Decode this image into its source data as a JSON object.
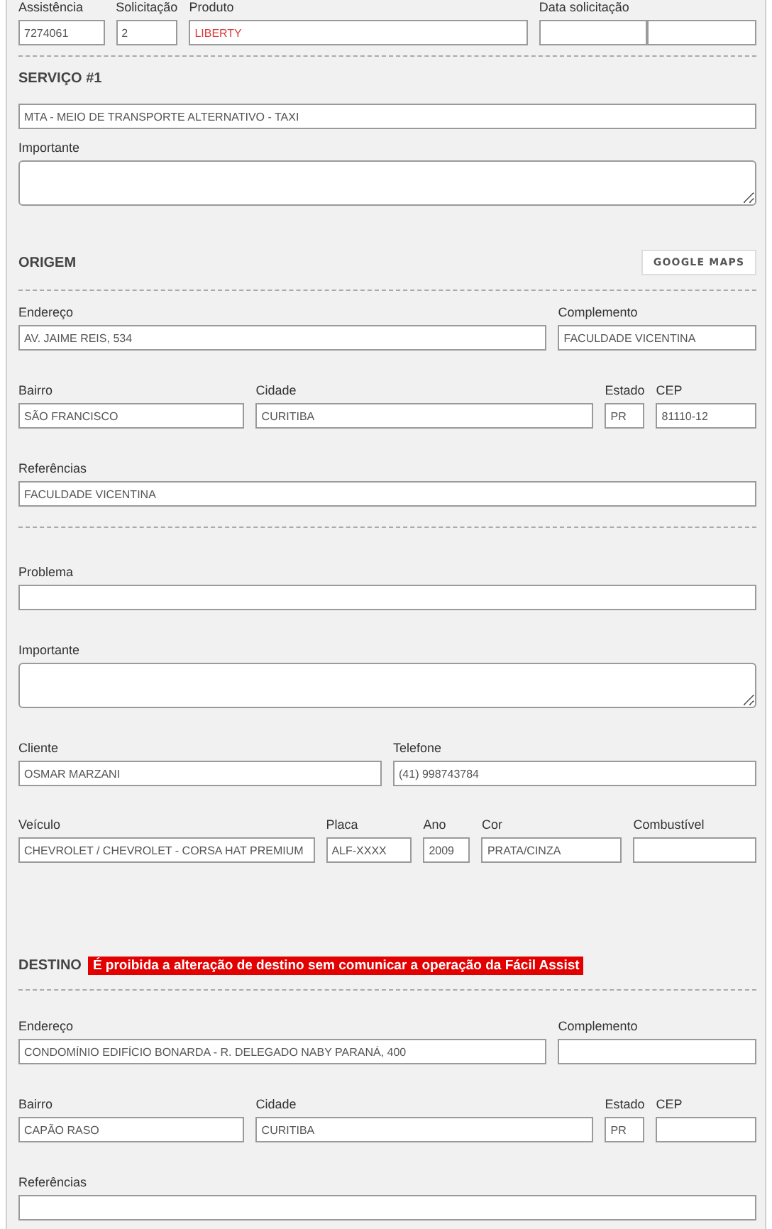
{
  "header_fields": [
    {
      "label": "Assistência",
      "value": "7274061",
      "kind": "plain"
    },
    {
      "label": "Solicitação",
      "value": "2",
      "kind": "plain"
    },
    {
      "label": "Produto",
      "value": "LIBERTY",
      "kind": "alert"
    },
    {
      "label": "Data solicitação",
      "kind": "plain"
    },
    {
      "kind": "plain"
    }
  ],
  "service": {
    "title": "SERVIÇO #1",
    "value": "MTA - MEIO DE TRANSPORTE ALTERNATIVO - TAXI",
    "notes_label": "Importante"
  },
  "origin": {
    "title": "ORIGEM",
    "map_button": "GOOGLE MAPS",
    "address": {
      "street": {
        "label": "Endereço",
        "value": "AV. JAIME REIS, 534"
      },
      "complement": {
        "label": "Complemento",
        "value": "FACULDADE VICENTINA"
      },
      "district": {
        "label": "Bairro",
        "value": "SÃO FRANCISCO"
      },
      "city": {
        "label": "Cidade",
        "value": "CURITIBA"
      },
      "state": {
        "label": "Estado",
        "value": "PR"
      },
      "zip": {
        "label": "CEP",
        "value": "81110-12"
      },
      "references": {
        "label": "Referências",
        "value": "FACULDADE VICENTINA"
      }
    }
  },
  "problem": {
    "label": "Problema",
    "notes_label": "Importante"
  },
  "client": [
    {
      "label": "Cliente",
      "value": "OSMAR MARZANI"
    },
    {
      "label": "Telefone",
      "value": "(41) 998743784"
    }
  ],
  "vehicle": [
    {
      "label": "Veículo",
      "value": "CHEVROLET / CHEVROLET - CORSA HAT PREMIUM"
    },
    {
      "label": "Placa",
      "value": "ALF-XXXX"
    },
    {
      "label": "Ano",
      "value": "2009"
    },
    {
      "label": "Cor",
      "value": "PRATA/CINZA"
    },
    {
      "label": "Combustível"
    }
  ],
  "destination": {
    "title": "DESTINO",
    "warning": "É proibida a alteração de destino sem comunicar a operação da Fácil Assist",
    "address": {
      "street": {
        "label": "Endereço",
        "value": "CONDOMÍNIO EDIFÍCIO BONARDA - R. DELEGADO NABY PARANÁ, 400"
      },
      "complement": {
        "label": "Complemento"
      },
      "district": {
        "label": "Bairro",
        "value": "CAPÃO RASO"
      },
      "city": {
        "label": "Cidade",
        "value": "CURITIBA"
      },
      "state": {
        "label": "Estado",
        "value": "PR"
      },
      "zip": {
        "label": "CEP"
      },
      "references": {
        "label": "Referências"
      }
    }
  }
}
